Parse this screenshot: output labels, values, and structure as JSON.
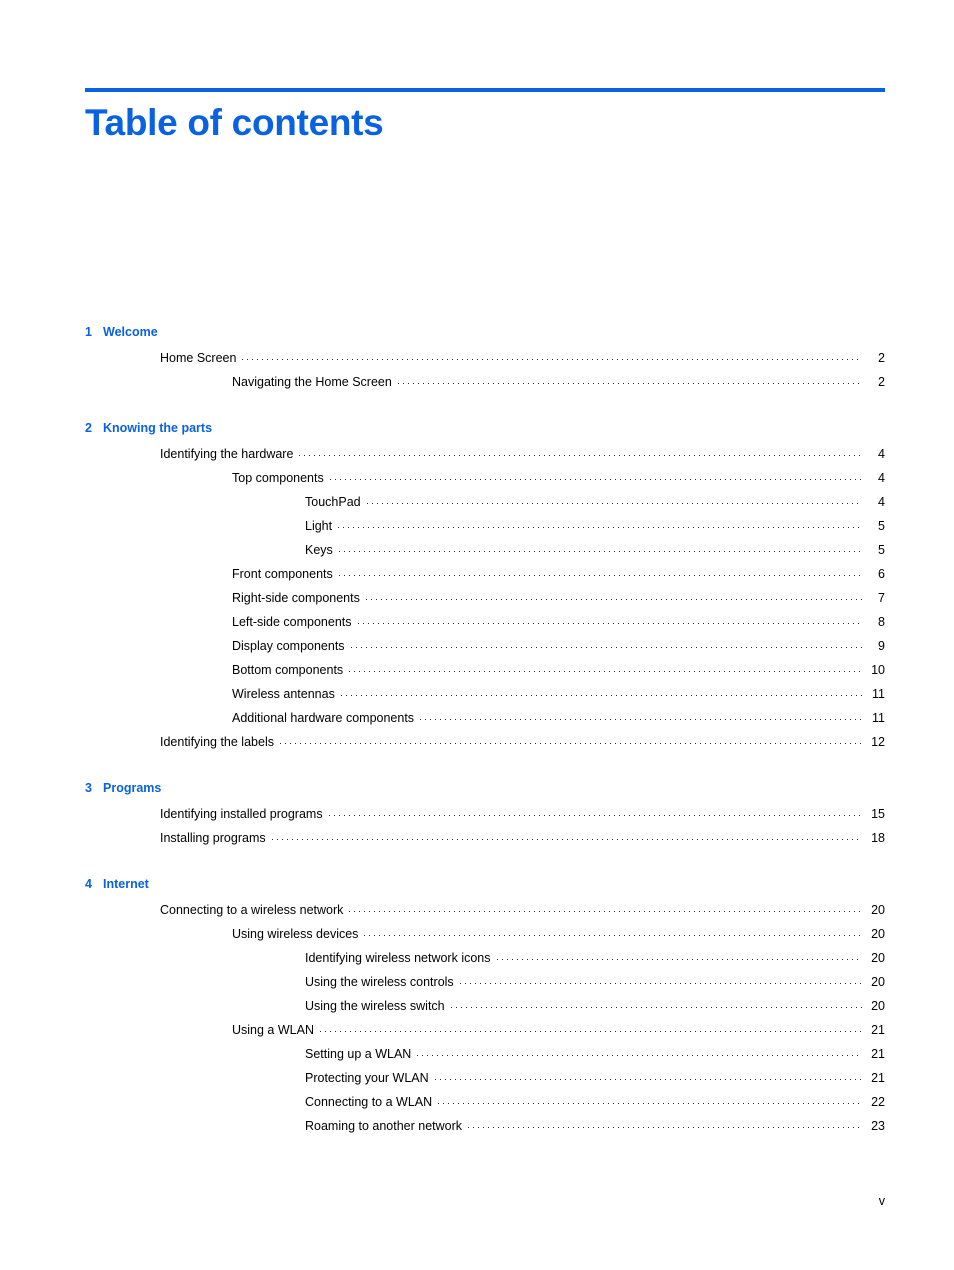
{
  "document": {
    "title": "Table of contents",
    "accent_color": "#0A62E0",
    "text_color": "#000000",
    "footer_page_label": "v"
  },
  "toc": {
    "chapters": [
      {
        "number": "1",
        "title": "Welcome",
        "entries": [
          {
            "level": 1,
            "label": "Home Screen",
            "page": "2"
          },
          {
            "level": 2,
            "label": "Navigating the Home Screen",
            "page": "2"
          }
        ]
      },
      {
        "number": "2",
        "title": "Knowing the parts",
        "entries": [
          {
            "level": 1,
            "label": "Identifying the hardware",
            "page": "4"
          },
          {
            "level": 2,
            "label": "Top components",
            "page": "4"
          },
          {
            "level": 3,
            "label": "TouchPad",
            "page": "4"
          },
          {
            "level": 3,
            "label": "Light",
            "page": "5"
          },
          {
            "level": 3,
            "label": "Keys",
            "page": "5"
          },
          {
            "level": 2,
            "label": "Front components",
            "page": "6"
          },
          {
            "level": 2,
            "label": "Right-side components",
            "page": "7"
          },
          {
            "level": 2,
            "label": "Left-side components",
            "page": "8"
          },
          {
            "level": 2,
            "label": "Display components",
            "page": "9"
          },
          {
            "level": 2,
            "label": "Bottom components",
            "page": "10"
          },
          {
            "level": 2,
            "label": "Wireless antennas",
            "page": "11"
          },
          {
            "level": 2,
            "label": "Additional hardware components",
            "page": "11"
          },
          {
            "level": 1,
            "label": "Identifying the labels",
            "page": "12"
          }
        ]
      },
      {
        "number": "3",
        "title": "Programs",
        "entries": [
          {
            "level": 1,
            "label": "Identifying installed programs",
            "page": "15"
          },
          {
            "level": 1,
            "label": "Installing programs",
            "page": "18"
          }
        ]
      },
      {
        "number": "4",
        "title": "Internet",
        "entries": [
          {
            "level": 1,
            "label": "Connecting to a wireless network",
            "page": "20"
          },
          {
            "level": 2,
            "label": "Using wireless devices",
            "page": "20"
          },
          {
            "level": 3,
            "label": "Identifying wireless network icons",
            "page": "20"
          },
          {
            "level": 3,
            "label": "Using the wireless controls",
            "page": "20"
          },
          {
            "level": 3,
            "label": "Using the wireless switch",
            "page": "20"
          },
          {
            "level": 2,
            "label": "Using a WLAN",
            "page": "21"
          },
          {
            "level": 3,
            "label": "Setting up a WLAN",
            "page": "21"
          },
          {
            "level": 3,
            "label": "Protecting your WLAN",
            "page": "21"
          },
          {
            "level": 3,
            "label": "Connecting to a WLAN",
            "page": "22"
          },
          {
            "level": 3,
            "label": "Roaming to another network",
            "page": "23"
          }
        ]
      }
    ]
  }
}
